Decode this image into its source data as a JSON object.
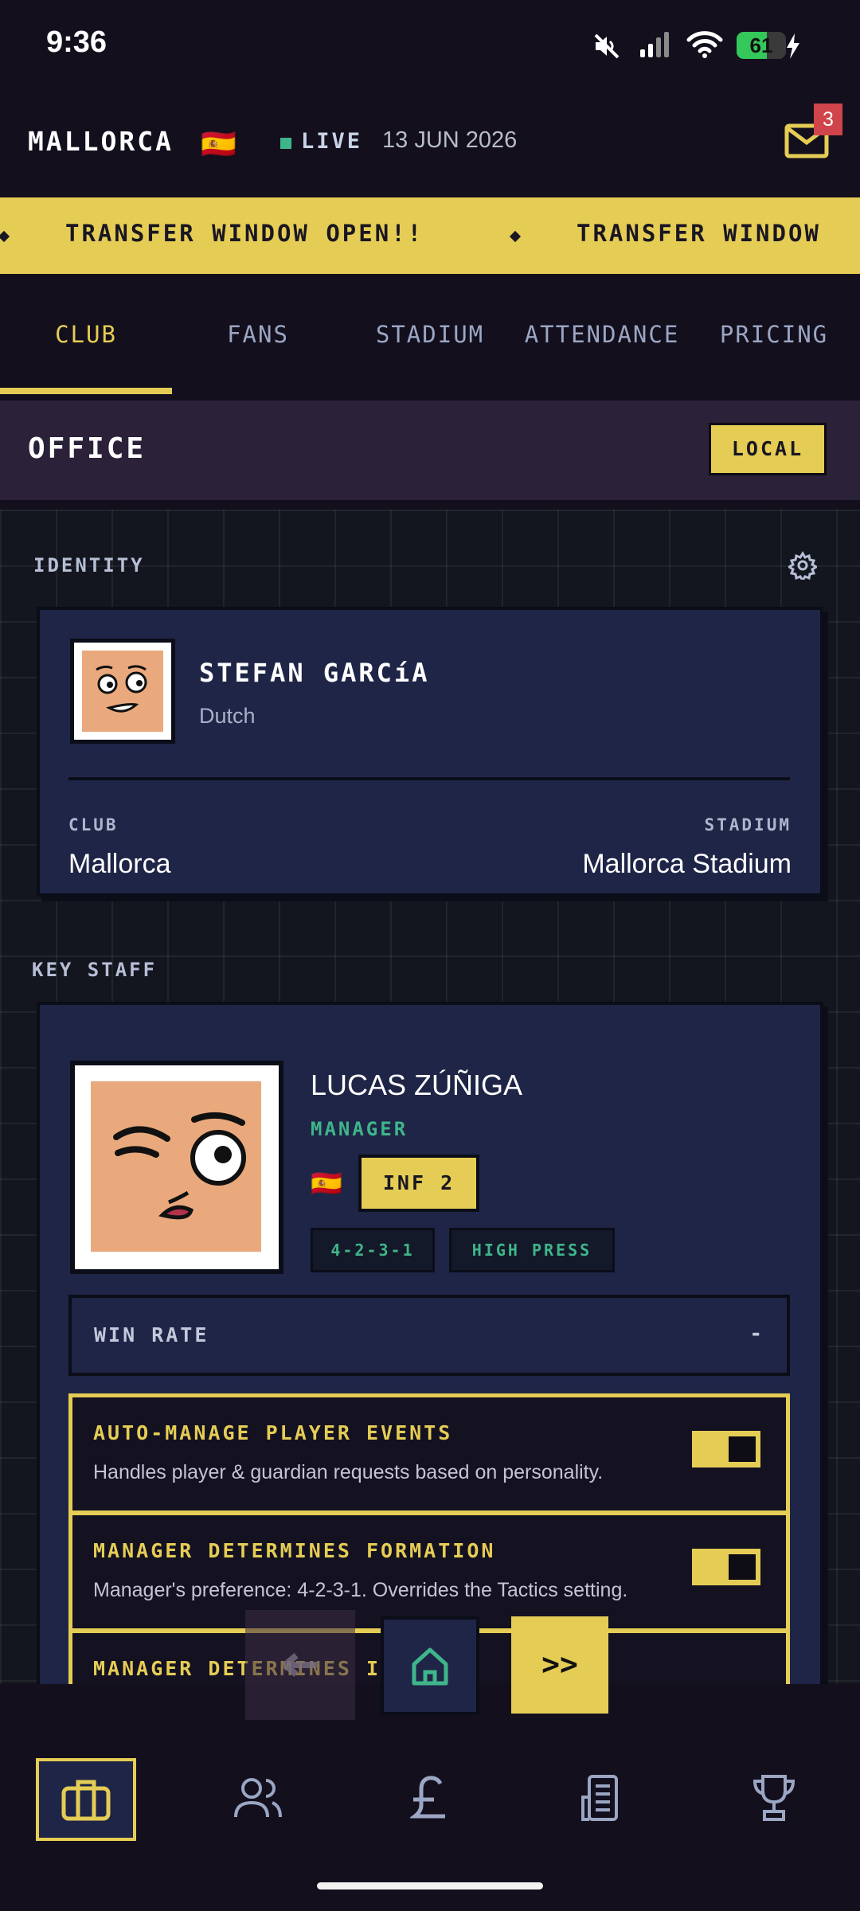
{
  "status_bar": {
    "time": "9:36",
    "battery": "61",
    "battery_level": 0.61
  },
  "header": {
    "club_name": "MALLORCA",
    "flag": "🇪🇸",
    "live_label": "LIVE",
    "date": "13 JUN 2026",
    "mail_badge": "3"
  },
  "ticker": {
    "items": [
      "TRANSFER WINDOW OPEN!!",
      "TRANSFER WINDOW"
    ]
  },
  "tabs": [
    "CLUB",
    "FANS",
    "STADIUM",
    "ATTENDANCE",
    "PRICING"
  ],
  "office": {
    "title": "OFFICE",
    "scope_button": "LOCAL"
  },
  "identity": {
    "section_label": "IDENTITY",
    "name": "STEFAN GARCíA",
    "nationality": "Dutch",
    "club_label": "CLUB",
    "club_value": "Mallorca",
    "stadium_label": "STADIUM",
    "stadium_value": "Mallorca Stadium"
  },
  "key_staff": {
    "section_label": "KEY STAFF",
    "name": "LUCAS ZÚÑIGA",
    "role": "MANAGER",
    "flag": "🇪🇸",
    "influence": "INF 2",
    "tags": [
      "4-2-3-1",
      "HIGH PRESS"
    ],
    "win_rate_label": "WIN RATE",
    "win_rate_value": "-",
    "settings": [
      {
        "title": "AUTO-MANAGE PLAYER EVENTS",
        "desc": "Handles player & guardian requests based on personality.",
        "enabled": true
      },
      {
        "title": "MANAGER DETERMINES FORMATION",
        "desc": "Manager's preference: 4-2-3-1. Overrides the Tactics setting.",
        "enabled": true
      },
      {
        "title": "MANAGER DETERMINES INC",
        "desc": "",
        "enabled": true
      }
    ]
  },
  "controls": {
    "skip_label": ">>"
  },
  "bottom_nav": [
    "briefcase-icon",
    "users-icon",
    "pound-icon",
    "building-icon",
    "trophy-icon"
  ],
  "colors": {
    "accent": "#e5cd55",
    "green": "#3fb58a",
    "card": "#1f2547",
    "background": "#130f1d",
    "badge": "#d0454b"
  }
}
